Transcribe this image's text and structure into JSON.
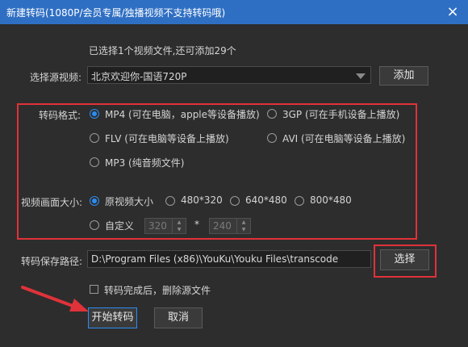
{
  "window": {
    "title": "新建转码(1080P/会员专属/独播视频不支持转码哦)",
    "close_symbol": "×"
  },
  "source": {
    "info": "已选择1个视频文件,还可添加29个",
    "label": "选择源视频:",
    "selected": "北京欢迎你-国语720P",
    "add_button": "添加"
  },
  "format": {
    "label": "转码格式:",
    "options": [
      {
        "label": "MP4 (可在电脑，apple等设备播放)",
        "checked": true
      },
      {
        "label": "3GP  (可在手机设备上播放)",
        "checked": false
      },
      {
        "label": "FLV  (可在电脑等设备上播放)",
        "checked": false
      },
      {
        "label": "AVI  (可在电脑等设备上播放)",
        "checked": false
      },
      {
        "label": "MP3 (纯音频文件)",
        "checked": false
      }
    ]
  },
  "size": {
    "label": "视频画面大小:",
    "options": [
      {
        "label": "原视频大小",
        "checked": true
      },
      {
        "label": "480*320",
        "checked": false
      },
      {
        "label": "640*480",
        "checked": false
      },
      {
        "label": "800*480",
        "checked": false
      },
      {
        "label": "自定义",
        "checked": false
      }
    ],
    "custom_width": "320",
    "times": "*",
    "custom_height": "240"
  },
  "output": {
    "label": "转码保存路径:",
    "path": "D:\\Program Files (x86)\\YouKu\\Youku Files\\transcode",
    "choose_button": "选择"
  },
  "delete_source": {
    "label": "转码完成后，删除源文件",
    "checked": false
  },
  "actions": {
    "start": "开始转码",
    "cancel": "取消"
  },
  "colors": {
    "titlebar": "#2f6fc3",
    "accent": "#2d8cf0",
    "highlight_box": "#e0323a"
  }
}
